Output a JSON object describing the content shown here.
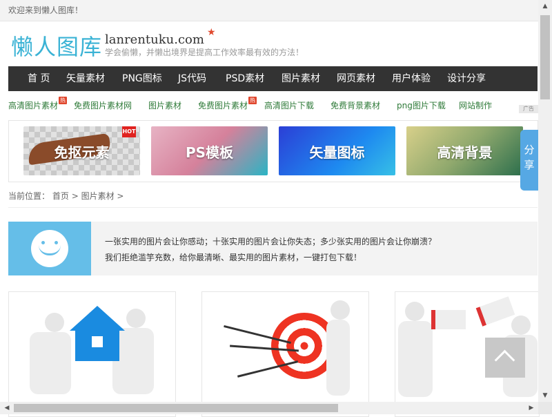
{
  "topbar": {
    "welcome": "欢迎来到懒人图库！"
  },
  "header": {
    "logo_cn": "懒人图库",
    "logo_en": "lanrentuku.com",
    "star": "★",
    "slogan": "学会偷懒，并懒出境界是提高工作效率最有效的方法！"
  },
  "nav": {
    "items": [
      "首 页",
      "矢量素材",
      "PNG图标",
      "JS代码",
      "PSD素材",
      "图片素材",
      "网页素材",
      "用户体验",
      "设计分享"
    ]
  },
  "subnav": {
    "items": [
      "高清图片素材",
      "免费图片素材网",
      "图片素材",
      "免费图片素材",
      "高清图片下载",
      "免费背景素材",
      "png图片下载",
      "网站制作"
    ],
    "hot_label": "热",
    "ad_label": "广告"
  },
  "banners": {
    "items": [
      "免抠元素",
      "PS模板",
      "矢量图标",
      "高清背景"
    ],
    "hot_tag": "HOT"
  },
  "share_tab": {
    "line1": "分",
    "line2": "享"
  },
  "breadcrumb": {
    "prefix": "当前位置：",
    "home": "首页",
    "sep": ">",
    "current": "图片素材",
    "trail": ">"
  },
  "intro": {
    "line1": "一张实用的图片会让你感动；十张实用的图片会让你失态；多少张实用的图片会让你崩溃？",
    "line2": "我们拒绝滥竽充数，给你最清晰、最实用的图片素材，一键打包下载！"
  },
  "scrollbars": {
    "up": "▲",
    "down": "▼",
    "left": "◀",
    "right": "▶"
  },
  "colors": {
    "accent": "#3bb3d5",
    "nav_bg": "#333333",
    "link_green": "#2e7a38",
    "hot_red": "#e0462d",
    "intro_blue": "#65bee8"
  }
}
